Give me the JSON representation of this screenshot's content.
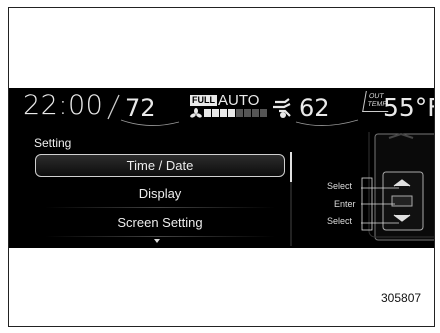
{
  "status_bar": {
    "time": "22:00",
    "temp_left": "72",
    "full_badge": "FULL",
    "auto_label": "AUTO",
    "fan_level": 4,
    "fan_max": 8,
    "temp_right": "62",
    "out_temp_label_1": "OUT",
    "out_temp_label_2": "TEMP",
    "out_temp_value": "55°F"
  },
  "screen_title": "Setting",
  "menu": {
    "items": [
      {
        "label": "Time / Date",
        "selected": true
      },
      {
        "label": "Display",
        "selected": false
      },
      {
        "label": "Screen Setting",
        "selected": false
      }
    ]
  },
  "controls": {
    "select_up": "Select",
    "enter": "Enter",
    "select_down": "Select"
  },
  "figure_number": "305807",
  "icons": {
    "fan": "fan-icon",
    "air_flow": "air-flow-icon",
    "scroll_down": "chevron-down-icon"
  }
}
